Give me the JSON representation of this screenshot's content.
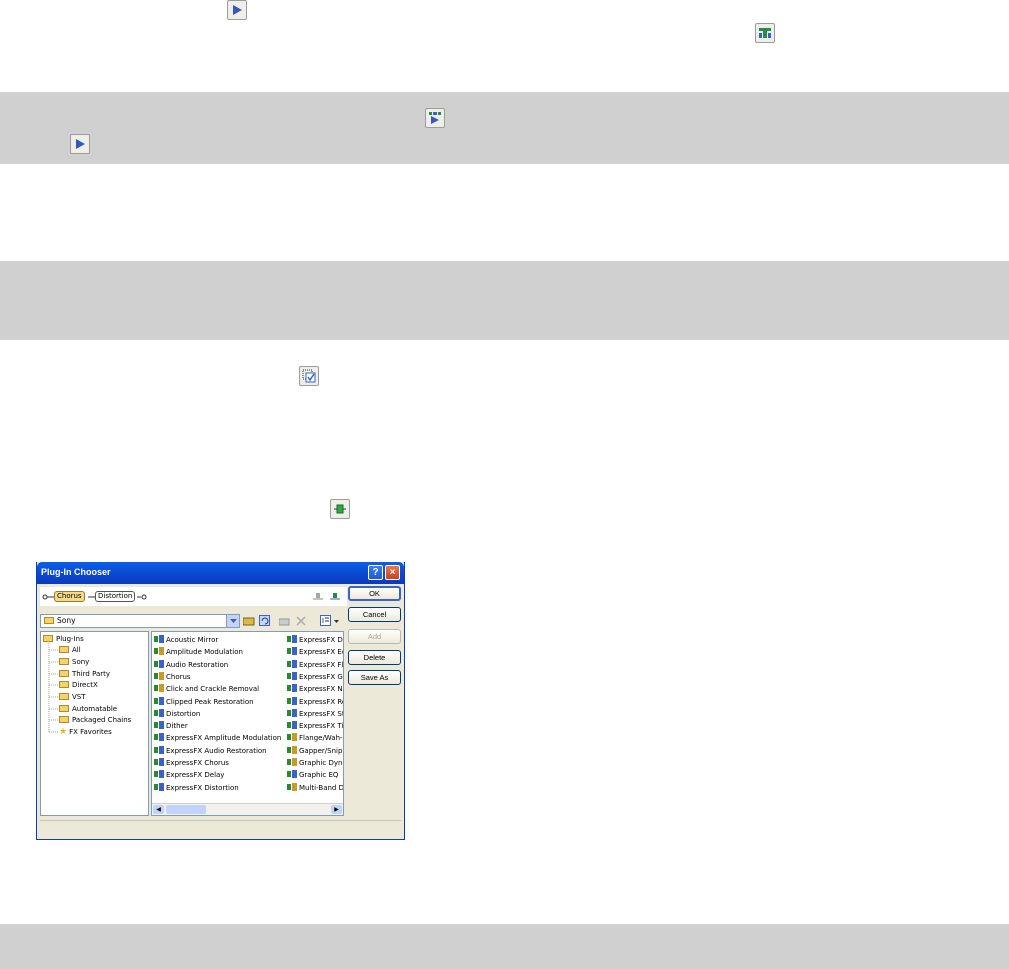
{
  "dialog": {
    "title": "Plug-In Chooser",
    "help_label": "?",
    "close_label": "×",
    "chain": [
      "Chorus",
      "Distortion"
    ],
    "folder": "Sony",
    "buttons": {
      "ok": "OK",
      "cancel": "Cancel",
      "add": "Add",
      "delete": "Delete",
      "save_as": "Save As"
    },
    "tree": [
      "Plug-Ins",
      "All",
      "Sony",
      "Third Party",
      "DirectX",
      "VST",
      "Automatable",
      "Packaged Chains",
      "FX Favorites"
    ],
    "plugins_col1": [
      "Acoustic Mirror",
      "Amplitude Modulation",
      "Audio Restoration",
      "Chorus",
      "Click and Crackle Removal",
      "Clipped Peak Restoration",
      "Distortion",
      "Dither",
      "ExpressFX Amplitude Modulation",
      "ExpressFX Audio Restoration",
      "ExpressFX Chorus",
      "ExpressFX Delay",
      "ExpressFX Distortion"
    ],
    "plugins_col2": [
      "ExpressFX D",
      "ExpressFX Ec",
      "ExpressFX Fl",
      "ExpressFX Gr",
      "ExpressFX No",
      "ExpressFX Re",
      "ExpressFX St",
      "ExpressFX Ti",
      "Flange/Wah-",
      "Gapper/Snipp",
      "Graphic Dyna",
      "Graphic EQ",
      "Multi-Band D"
    ]
  }
}
